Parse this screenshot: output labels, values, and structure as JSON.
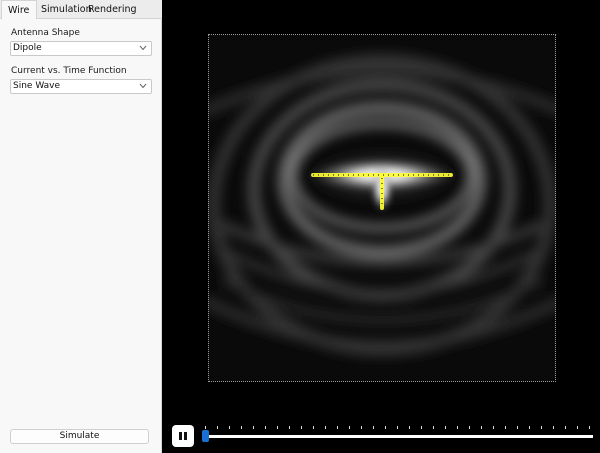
{
  "tabs": [
    {
      "label": "Wire",
      "active": true
    },
    {
      "label": "Simulation",
      "active": false
    },
    {
      "label": "Rendering",
      "active": false
    }
  ],
  "wire_panel": {
    "antenna_shape_label": "Antenna Shape",
    "antenna_shape_value": "Dipole",
    "current_fn_label": "Current vs. Time Function",
    "current_fn_value": "Sine Wave"
  },
  "simulate_button": "Simulate",
  "playback": {
    "state": "playing",
    "progress": 0.0,
    "thumb_color": "#1a6fd4"
  },
  "render": {
    "wire_color": "#ffff00",
    "field_color": "grayscale"
  },
  "icons": {
    "dropdown": "chevron-down-icon",
    "pause": "pause-icon"
  }
}
